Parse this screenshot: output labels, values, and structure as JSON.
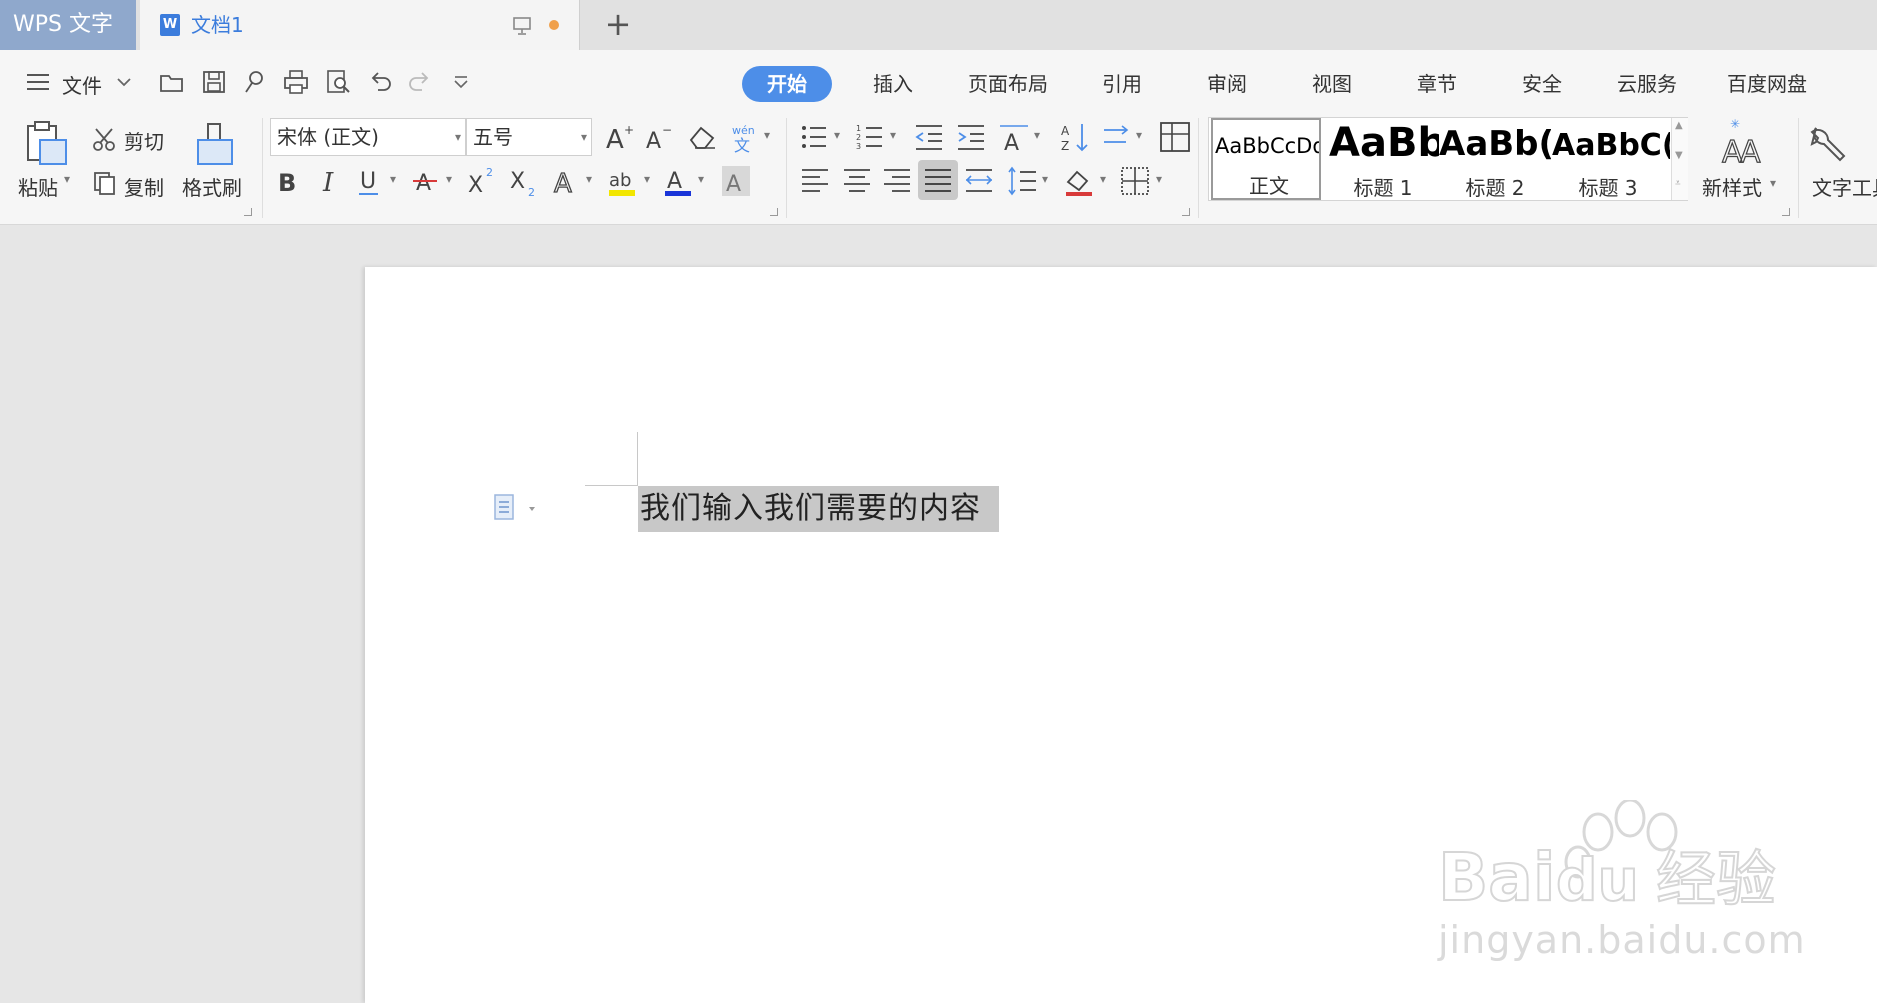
{
  "titlebar": {
    "app_name": "WPS 文字",
    "doc_tab": "文档1",
    "new_tab": "+"
  },
  "quickbar": {
    "menu_label": "文件"
  },
  "tabs": [
    "开始",
    "插入",
    "页面布局",
    "引用",
    "审阅",
    "视图",
    "章节",
    "安全",
    "云服务",
    "百度网盘"
  ],
  "clipboard": {
    "paste": "粘贴",
    "cut": "剪切",
    "copy": "复制",
    "format_painter": "格式刷"
  },
  "font": {
    "family": "宋体 (正文)",
    "size": "五号"
  },
  "styles": {
    "normal_preview": "AaBbCcDd",
    "normal_name": "正文",
    "h1_preview": "AaBb",
    "h1_name": "标题 1",
    "h2_preview": "AaBb(",
    "h2_name": "标题 2",
    "h3_preview": "AaBbC(",
    "h3_name": "标题 3",
    "new_style": "新样式",
    "text_tools": "文字工具"
  },
  "document": {
    "selected_text": "我们输入我们需要的内容"
  },
  "watermark": {
    "brand": "Baidu经验",
    "url": "jingyan.baidu.com"
  },
  "colors": {
    "accent": "#4d8ee8",
    "selection": "#c8c8c8",
    "highlight_yellow": "#f2e600",
    "font_color_blue": "#1a35d8"
  }
}
